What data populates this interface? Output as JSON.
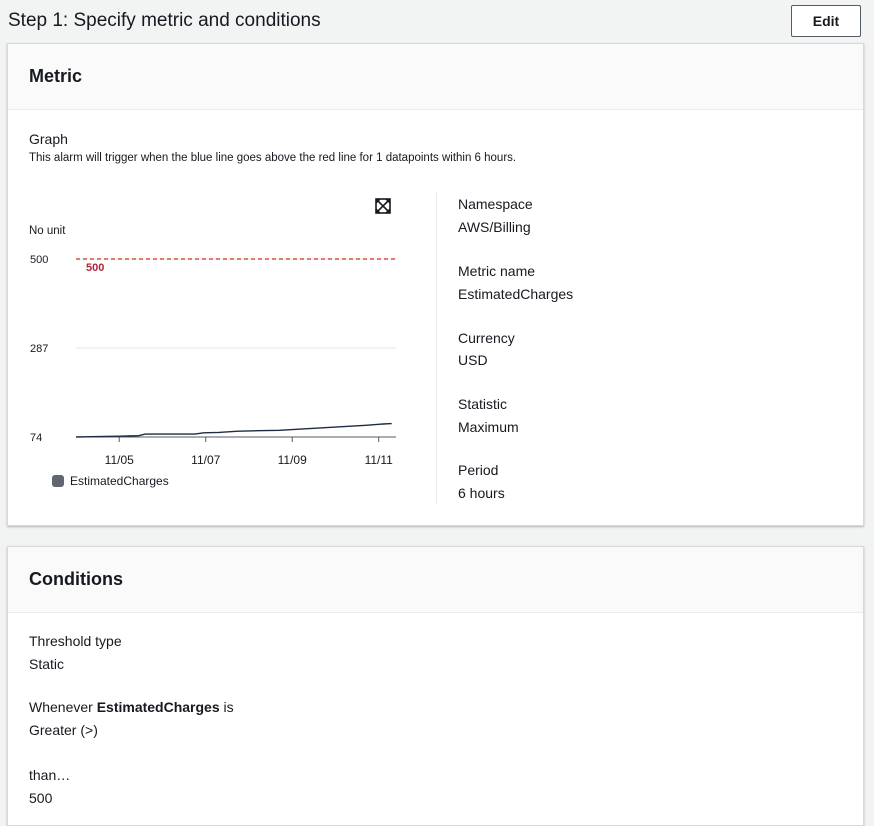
{
  "step": {
    "title": "Step 1: Specify metric and conditions",
    "edit_label": "Edit"
  },
  "metric_card": {
    "heading": "Metric",
    "graph_label": "Graph",
    "graph_description": "This alarm will trigger when the blue line goes above the red line for 1 datapoints within 6 hours.",
    "unit_label": "No unit",
    "expand_icon": "expand-icon",
    "details": [
      {
        "key": "Namespace",
        "value": "AWS/Billing"
      },
      {
        "key": "Metric name",
        "value": "EstimatedCharges"
      },
      {
        "key": "Currency",
        "value": "USD"
      },
      {
        "key": "Statistic",
        "value": "Maximum"
      },
      {
        "key": "Period",
        "value": "6 hours"
      }
    ]
  },
  "chart_data": {
    "type": "line",
    "ylabel": "No unit",
    "y_ticks": [
      "500",
      "287",
      "74"
    ],
    "x_ticks": [
      "11/05",
      "11/07",
      "11/09",
      "11/11"
    ],
    "ylim": [
      74,
      500
    ],
    "x_range": [
      "11/04",
      "11/11"
    ],
    "threshold": {
      "value": 500,
      "label": "500",
      "color": "#d13212"
    },
    "series": [
      {
        "name": "EstimatedCharges",
        "color": "#1f2a44",
        "x": [
          "11/04",
          "11/04.5",
          "11/05",
          "11/05.5",
          "11/06",
          "11/06.5",
          "11/07",
          "11/07.5",
          "11/08",
          "11/08.5",
          "11/09",
          "11/09.5",
          "11/10",
          "11/10.5",
          "11/11",
          "11/11.3"
        ],
        "points": [
          [
            0.0,
            74
          ],
          [
            0.5,
            75
          ],
          [
            1.0,
            76
          ],
          [
            1.45,
            77
          ],
          [
            1.6,
            81
          ],
          [
            2.4,
            81
          ],
          [
            2.75,
            81
          ],
          [
            2.95,
            84
          ],
          [
            3.3,
            85
          ],
          [
            3.75,
            88
          ],
          [
            4.2,
            89
          ],
          [
            4.7,
            90
          ],
          [
            5.2,
            93
          ],
          [
            5.7,
            96
          ],
          [
            6.2,
            99
          ],
          [
            6.7,
            102
          ],
          [
            7.1,
            105
          ],
          [
            7.3,
            106
          ]
        ]
      }
    ],
    "grid": true,
    "legend": "bottom-left"
  },
  "conditions_card": {
    "heading": "Conditions",
    "threshold_type_label": "Threshold type",
    "threshold_type_value": "Static",
    "whenever_prefix": "Whenever ",
    "whenever_metric": "EstimatedCharges",
    "whenever_suffix": " is",
    "comparison_value": "Greater (>)",
    "than_label": "than…",
    "than_value": "500"
  }
}
